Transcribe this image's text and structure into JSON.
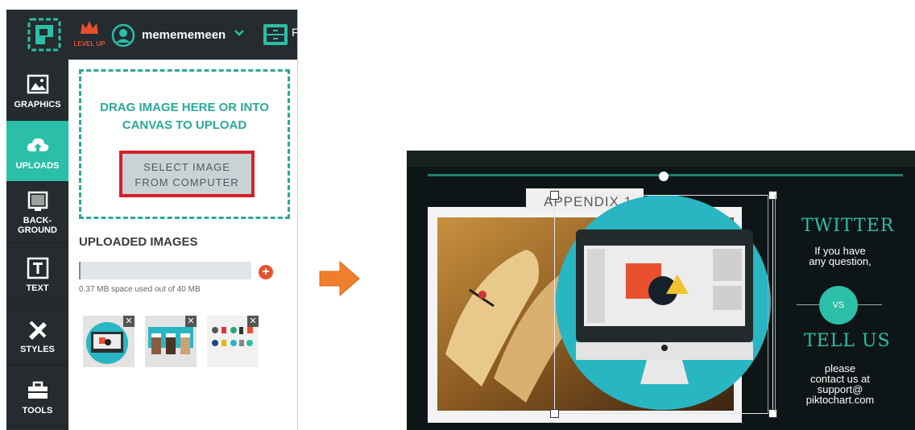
{
  "topbar": {
    "level_up_label": "LEVEL UP",
    "username": "memememeen",
    "caret": "⌄",
    "edge_glyph": "F"
  },
  "sidenav": {
    "items": [
      {
        "label": "GRAPHICS",
        "icon": "image-icon"
      },
      {
        "label": "UPLOADS",
        "icon": "cloud-upload-icon",
        "active": true
      },
      {
        "label": "BACK-\nGROUND",
        "label_line1": "BACK-",
        "label_line2": "GROUND",
        "icon": "background-icon"
      },
      {
        "label": "TEXT",
        "icon": "text-icon"
      },
      {
        "label": "STYLES",
        "icon": "styles-icon"
      },
      {
        "label": "TOOLS",
        "icon": "toolbox-icon"
      }
    ]
  },
  "upload_panel": {
    "drop_text_line1": "DRAG IMAGE HERE OR INTO",
    "drop_text_line2": "CANVAS TO UPLOAD",
    "select_line1": "SELECT IMAGE",
    "select_line2": "FROM COMPUTER",
    "uploaded_heading": "UPLOADED IMAGES",
    "add_label": "+",
    "storage_used": 0.37,
    "storage_total": 40,
    "space_text": "0.37 MB space used out of 40 MB",
    "remove_label": "✕"
  },
  "canvas": {
    "appendix": "APPENDIX 1",
    "twitter_heading": "TWITTER",
    "question_line1": "If you have",
    "question_line2": "any question,",
    "vs": "VS",
    "tellus_heading": "TELL US",
    "contact_line1": "please",
    "contact_line2": "contact us at",
    "contact_line3": "support@",
    "contact_line4": "piktochart.com"
  },
  "colors": {
    "accent": "#2bbfa7",
    "dark": "#252b2e",
    "highlight": "#d71f2a",
    "orange": "#e8502e",
    "arrow": "#ef7f2a"
  }
}
